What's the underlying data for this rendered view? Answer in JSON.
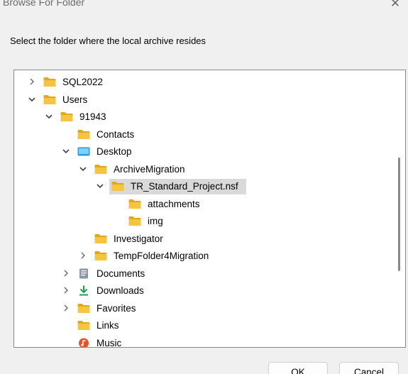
{
  "window": {
    "title": "Browse For Folder",
    "close_glyph": "✕"
  },
  "prompt": "Select the folder where the local archive resides",
  "tree": [
    {
      "label": "SQL2022",
      "icon": "folder-icon",
      "expander": "collapsed",
      "depth": 0
    },
    {
      "label": "Users",
      "icon": "folder-icon",
      "expander": "expanded",
      "depth": 0
    },
    {
      "label": "91943",
      "icon": "folder-icon",
      "expander": "expanded",
      "depth": 1
    },
    {
      "label": "Contacts",
      "icon": "folder-icon",
      "expander": "none",
      "depth": 2
    },
    {
      "label": "Desktop",
      "icon": "desktop-folder-icon",
      "expander": "expanded",
      "depth": 2
    },
    {
      "label": "ArchiveMigration",
      "icon": "folder-icon",
      "expander": "expanded",
      "depth": 3
    },
    {
      "label": "TR_Standard_Project.nsf",
      "icon": "folder-icon",
      "expander": "expanded",
      "depth": 4,
      "selected": true
    },
    {
      "label": "attachments",
      "icon": "folder-icon",
      "expander": "none",
      "depth": 5
    },
    {
      "label": "img",
      "icon": "folder-icon",
      "expander": "none",
      "depth": 5
    },
    {
      "label": "Investigator",
      "icon": "folder-icon",
      "expander": "none",
      "depth": 3
    },
    {
      "label": "TempFolder4Migration",
      "icon": "folder-icon",
      "expander": "collapsed",
      "depth": 3
    },
    {
      "label": "Documents",
      "icon": "documents-icon",
      "expander": "collapsed",
      "depth": 2
    },
    {
      "label": "Downloads",
      "icon": "download-icon",
      "expander": "collapsed",
      "depth": 2
    },
    {
      "label": "Favorites",
      "icon": "folder-icon",
      "expander": "collapsed",
      "depth": 2
    },
    {
      "label": "Links",
      "icon": "folder-icon",
      "expander": "none",
      "depth": 2
    },
    {
      "label": "Music",
      "icon": "music-icon",
      "expander": "none",
      "depth": 2
    }
  ],
  "buttons": {
    "ok": "OK",
    "cancel": "Cancel"
  },
  "colors": {
    "folder": "#f4c542",
    "folder_dark": "#e0a81c",
    "desktop": "#2b9be0",
    "download": "#1f9d55",
    "music": "#e0552b",
    "selection": "#d9d9d9"
  }
}
